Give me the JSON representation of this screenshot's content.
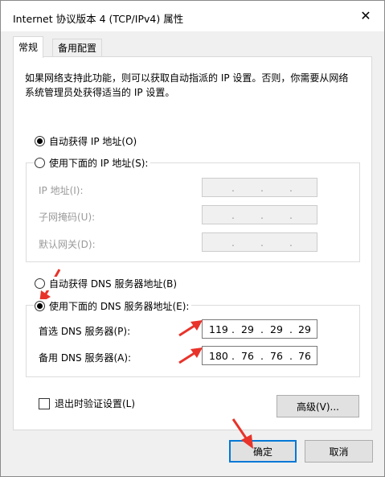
{
  "window": {
    "title": "Internet 协议版本 4 (TCP/IPv4) 属性",
    "close_glyph": "✕"
  },
  "tabs": [
    {
      "label": "常规",
      "active": true
    },
    {
      "label": "备用配置",
      "active": false
    }
  ],
  "intro_text": "如果网络支持此功能，则可以获取自动指派的 IP 设置。否则，你需要从网络系统管理员处获得适当的 IP 设置。",
  "ip_section": {
    "auto_label": "自动获得 IP 地址(O)",
    "auto_checked": true,
    "manual_label": "使用下面的 IP 地址(S):",
    "manual_checked": false,
    "fields": [
      {
        "label": "IP 地址(I):",
        "value": [
          "",
          "",
          "",
          ""
        ]
      },
      {
        "label": "子网掩码(U):",
        "value": [
          "",
          "",
          "",
          ""
        ]
      },
      {
        "label": "默认网关(D):",
        "value": [
          "",
          "",
          "",
          ""
        ]
      }
    ]
  },
  "dns_section": {
    "auto_label": "自动获得 DNS 服务器地址(B)",
    "auto_checked": false,
    "manual_label": "使用下面的 DNS 服务器地址(E):",
    "manual_checked": true,
    "fields": [
      {
        "label": "首选 DNS 服务器(P):",
        "value": [
          "119",
          "29",
          "29",
          "29"
        ]
      },
      {
        "label": "备用 DNS 服务器(A):",
        "value": [
          "180",
          "76",
          "76",
          "76"
        ]
      }
    ]
  },
  "validate_checkbox": {
    "label": "退出时验证设置(L)",
    "checked": false
  },
  "buttons": {
    "advanced": "高级(V)...",
    "ok": "确定",
    "cancel": "取消"
  },
  "annotation_color": "#e8332a"
}
